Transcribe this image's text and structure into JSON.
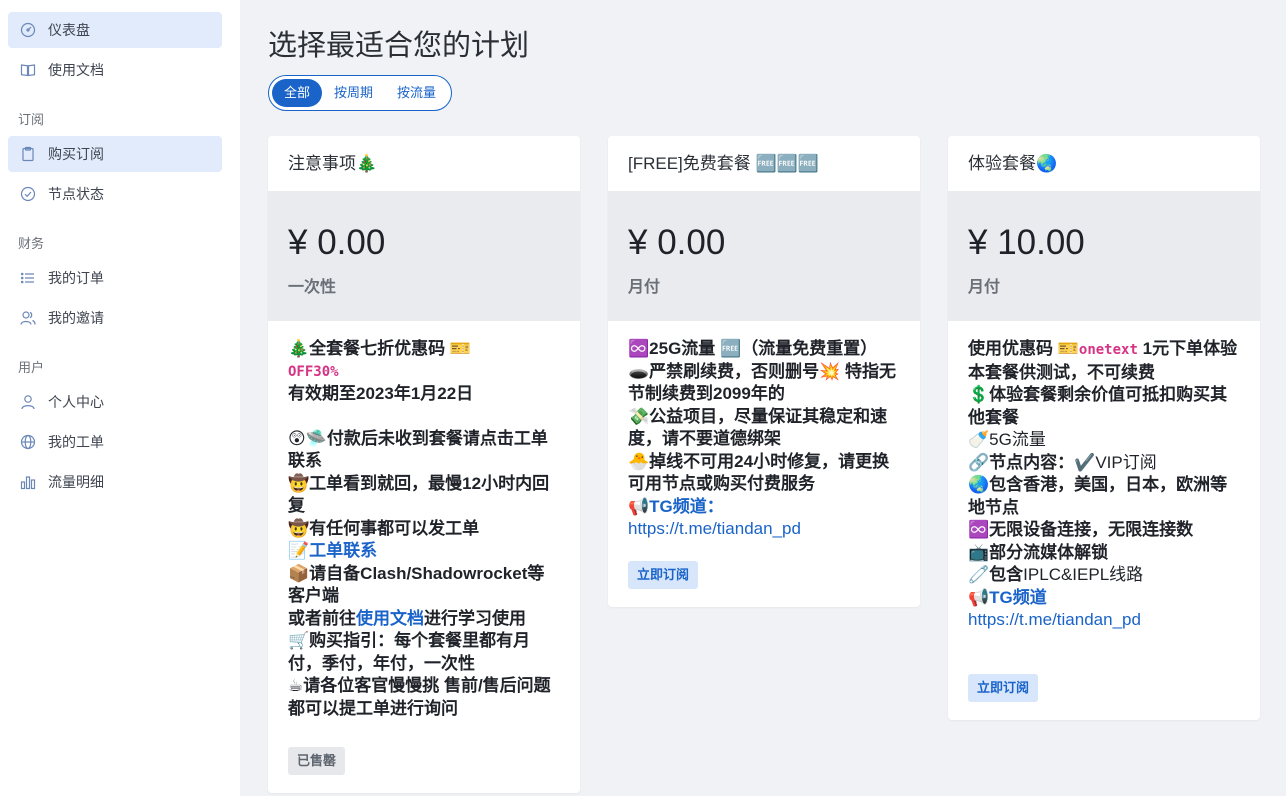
{
  "sidebar": {
    "items_top": [
      {
        "label": "仪表盘",
        "icon": "dashboard-icon"
      },
      {
        "label": "使用文档",
        "icon": "book-icon"
      }
    ],
    "section_subscribe": "订阅",
    "items_subscribe": [
      {
        "label": "购买订阅",
        "icon": "clipboard-icon"
      },
      {
        "label": "节点状态",
        "icon": "check-circle-icon"
      }
    ],
    "section_finance": "财务",
    "items_finance": [
      {
        "label": "我的订单",
        "icon": "list-icon"
      },
      {
        "label": "我的邀请",
        "icon": "users-icon"
      }
    ],
    "section_user": "用户",
    "items_user": [
      {
        "label": "个人中心",
        "icon": "user-icon"
      },
      {
        "label": "我的工单",
        "icon": "globe-icon"
      },
      {
        "label": "流量明细",
        "icon": "bar-chart-icon"
      }
    ]
  },
  "main": {
    "title": "选择最适合您的计划",
    "tabs": [
      "全部",
      "按周期",
      "按流量"
    ]
  },
  "cards": [
    {
      "title": "注意事项🎄",
      "price": "¥ 0.00",
      "period": "一次性",
      "lines": {
        "l1": "🎄全套餐七折优惠码 🎫",
        "l2": "OFF30%",
        "l3": "有效期至2023年1月22日",
        "l4": "😲🛸付款后未收到套餐请点击工单联系",
        "l5": "🤠工单看到就回，最慢12小时内回复",
        "l6": "🤠有任何事都可以发工单",
        "l7a": "📝",
        "l7b": "工单联系",
        "l8": "📦请自备Clash/Shadowrocket等客户端",
        "l9a": "或者前往",
        "l9b": "使用文档",
        "l9c": "进行学习使用",
        "l10": "🛒购买指引：每个套餐里都有月付，季付，年付，一次性",
        "l11": "☕请各位客官慢慢挑 售前/售后问题都可以提工单进行询问"
      },
      "button": "已售罄"
    },
    {
      "title": "[FREE]免费套餐 🆓🆓🆓",
      "price": "¥ 0.00",
      "period": "月付",
      "lines": {
        "l1": "♾️25G流量 🆓（流量免费重置）",
        "l2": "🕳️严禁刷续费，否则删号💥 特指无节制续费到2099年的",
        "l3": "💸公益项目，尽量保证其稳定和速度，请不要道德绑架",
        "l4": "🐣掉线不可用24小时修复，请更换可用节点或购买付费服务",
        "l5a": "📢",
        "l5b": "TG频道：",
        "l6": "https://t.me/tiandan_pd"
      },
      "button": "立即订阅"
    },
    {
      "title": "体验套餐🌏",
      "price": "¥ 10.00",
      "period": "月付",
      "lines": {
        "l1a": "使用优惠码 🎫",
        "l1b": "onetext",
        "l1c": " 1元下单体验",
        "l2": "本套餐供测试，不可续费",
        "l3": "💲体验套餐剩余价值可抵扣购买其他套餐",
        "l4": "🍼5G流量",
        "l5a": "🔗节点内容：✔️",
        "l5b": "VIP订阅",
        "l6": "🌏包含香港，美国，日本，欧洲等地节点",
        "l7": "♾️无限设备连接，无限连接数",
        "l8": "📺部分流媒体解锁",
        "l9a": "🧷包含",
        "l9b": "IPLC&IEPL线路",
        "l10a": "📢",
        "l10b": "TG频道",
        "l11": "https://t.me/tiandan_pd"
      },
      "button": "立即订阅"
    }
  ]
}
